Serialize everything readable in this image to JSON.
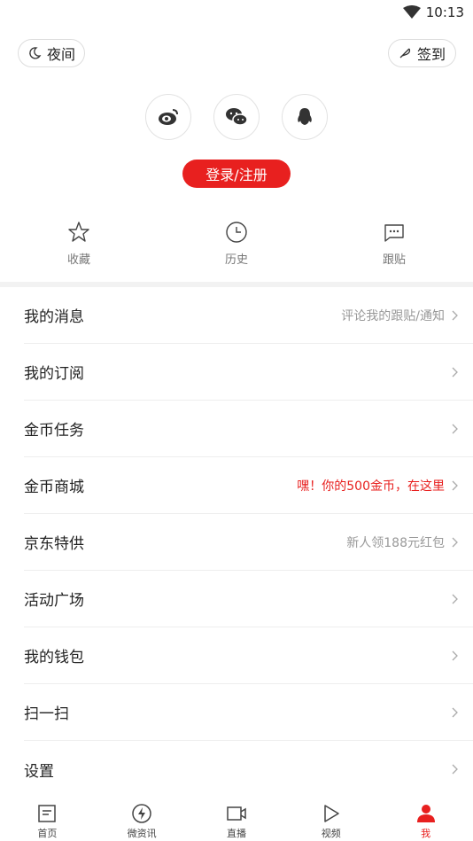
{
  "status_bar": {
    "time": "10:13"
  },
  "top_buttons": {
    "night_label": "夜间",
    "sign_label": "签到"
  },
  "social": {
    "weibo_icon": "weibo-icon",
    "wechat_icon": "wechat-icon",
    "qq_icon": "qq-icon"
  },
  "login": {
    "label": "登录/注册"
  },
  "shortcuts": [
    {
      "label": "收藏",
      "icon": "star-icon"
    },
    {
      "label": "历史",
      "icon": "clock-icon"
    },
    {
      "label": "跟贴",
      "icon": "comment-icon"
    }
  ],
  "menu": [
    {
      "title": "我的消息",
      "extra": "评论我的跟贴/通知"
    },
    {
      "title": "我的订阅",
      "extra": ""
    },
    {
      "title": "金币任务",
      "extra": ""
    },
    {
      "title": "金币商城",
      "extra": "嘿！你的500金币，在这里"
    },
    {
      "title": "京东特供",
      "extra": "新人领188元红包"
    },
    {
      "title": "活动广场",
      "extra": ""
    },
    {
      "title": "我的钱包",
      "extra": ""
    },
    {
      "title": "扫一扫",
      "extra": ""
    },
    {
      "title": "设置",
      "extra": ""
    }
  ],
  "tabs": [
    {
      "label": "首页",
      "icon": "home-icon"
    },
    {
      "label": "微资讯",
      "icon": "lightning-icon"
    },
    {
      "label": "直播",
      "icon": "live-camera-icon"
    },
    {
      "label": "视频",
      "icon": "play-icon"
    },
    {
      "label": "我",
      "icon": "user-icon",
      "active": true
    }
  ],
  "colors": {
    "accent": "#e8201f",
    "muted": "#999999"
  }
}
